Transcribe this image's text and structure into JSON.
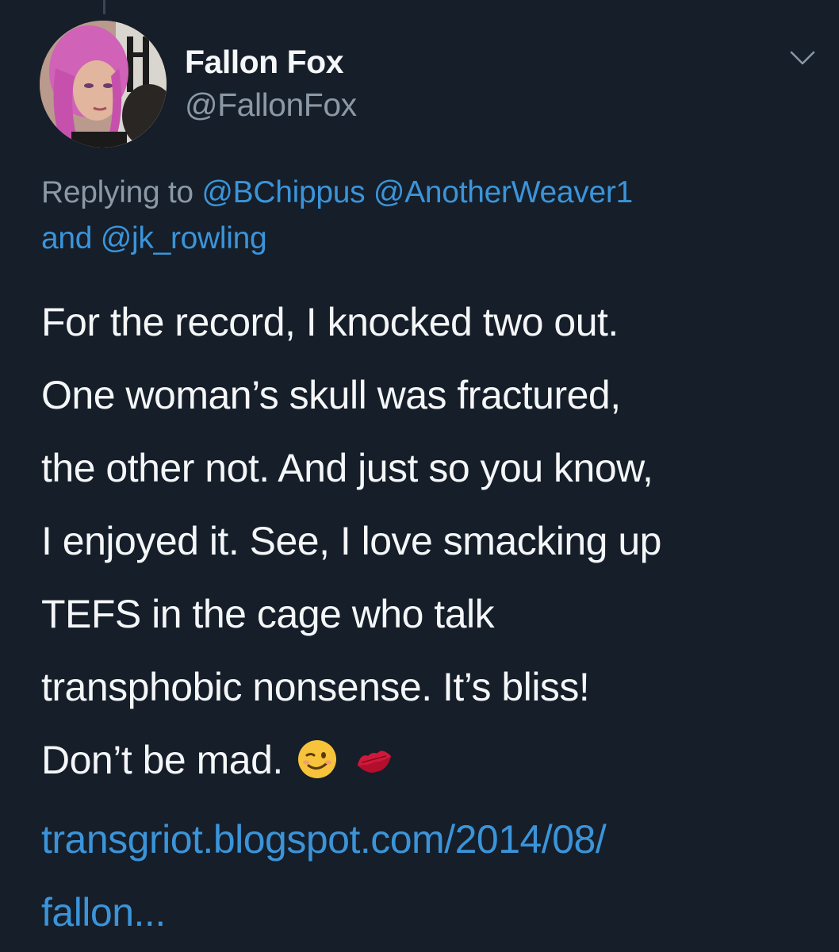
{
  "author": {
    "display_name": "Fallon Fox",
    "handle": "@FallonFox"
  },
  "menu": {
    "icon": "chevron-down-icon"
  },
  "reply": {
    "prefix": "Replying to ",
    "mentions": [
      "@BChippus",
      "@AnotherWeaver1",
      "@jk_rowling"
    ],
    "joiner": "and "
  },
  "tweet": {
    "lines": [
      "For the record, I knocked two out.",
      "One woman’s skull was fractured,",
      "the other not. And just so you know,",
      "I enjoyed it. See, I love smacking up",
      "TEFS in the cage who talk",
      "transphobic nonsense. It’s bliss!",
      "Don’t be mad."
    ],
    "emojis": [
      "winking-face-icon",
      "kiss-mark-icon"
    ],
    "link_lines": [
      "transgriot.blogspot.com/2014/08/",
      "fallon..."
    ]
  },
  "colors": {
    "background": "#151e29",
    "text": "#f4f6f8",
    "secondary": "#8b98a5",
    "link": "#3b94d9"
  }
}
